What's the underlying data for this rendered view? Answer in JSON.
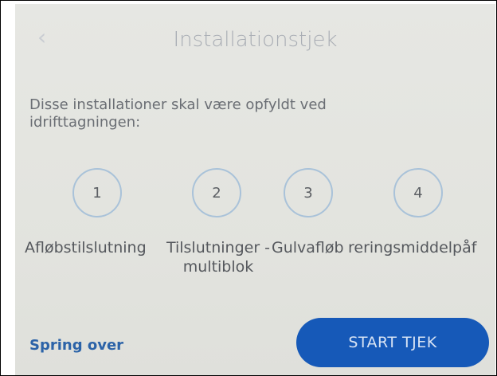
{
  "header": {
    "back_icon": "chevron-left-icon",
    "back_glyph": "‹",
    "title": "Installationstjek"
  },
  "instruction": "Disse installationer skal være opfyldt ved idrifttagningen:",
  "steps": [
    {
      "number": "1",
      "label": "Afløbstilslutning"
    },
    {
      "number": "2",
      "label": "Tilslutninger - multiblok"
    },
    {
      "number": "3",
      "label": "Gulvafløb"
    },
    {
      "number": "4",
      "label": "reringsmiddelpåf"
    }
  ],
  "footer": {
    "skip_label": "Spring over",
    "start_label": "START TJEK"
  },
  "colors": {
    "accent": "#1659b8",
    "link": "#2c63a8",
    "circle_border": "#a9c2d9"
  }
}
